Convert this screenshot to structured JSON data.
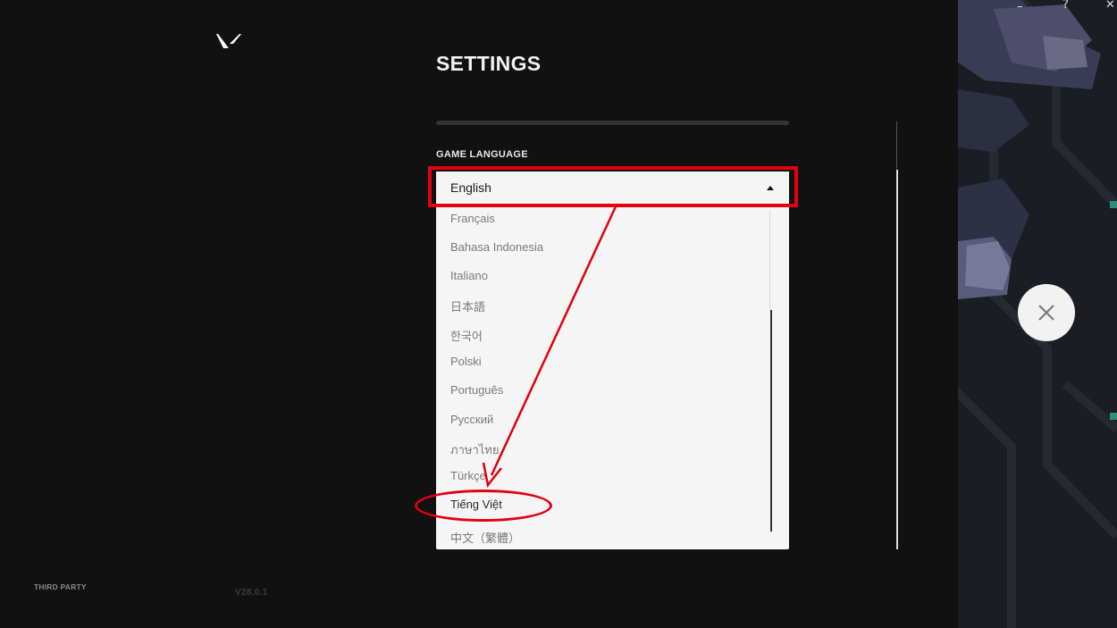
{
  "window": {
    "minimize_label": "–",
    "help_label": "?",
    "close_label": "✕"
  },
  "header": {
    "title": "SETTINGS",
    "logo_icon": "valorant-logo-icon"
  },
  "language": {
    "section_label": "GAME LANGUAGE",
    "selected": "English",
    "options": [
      "Français",
      "Bahasa Indonesia",
      "Italiano",
      "日本語",
      "한국어",
      "Polski",
      "Português",
      "Русский",
      "ภาษาไทย",
      "Türkçe",
      "Tiếng Việt",
      "中文（繁體）"
    ],
    "highlighted_option": "Tiếng Việt"
  },
  "footer": {
    "third_party_label": "THIRD PARTY",
    "version": "V28.0.1"
  },
  "colors": {
    "background": "#111111",
    "dropdown_bg": "#f5f5f5",
    "annotation_red": "#e3000f"
  }
}
